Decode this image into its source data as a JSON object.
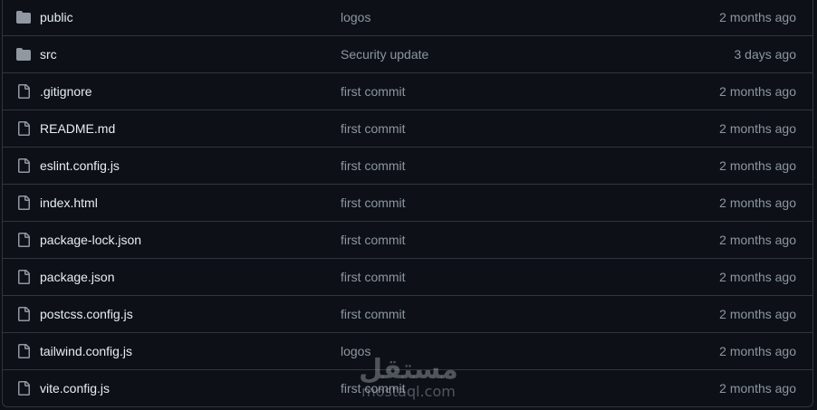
{
  "files": [
    {
      "name": "public",
      "type": "folder",
      "icon": "folder-icon",
      "commit": "logos",
      "date": "2 months ago"
    },
    {
      "name": "src",
      "type": "folder",
      "icon": "folder-icon",
      "commit": "Security update",
      "date": "3 days ago"
    },
    {
      "name": ".gitignore",
      "type": "file",
      "icon": "file-icon",
      "commit": "first commit",
      "date": "2 months ago"
    },
    {
      "name": "README.md",
      "type": "file",
      "icon": "file-icon",
      "commit": "first commit",
      "date": "2 months ago"
    },
    {
      "name": "eslint.config.js",
      "type": "file",
      "icon": "file-icon",
      "commit": "first commit",
      "date": "2 months ago"
    },
    {
      "name": "index.html",
      "type": "file",
      "icon": "file-icon",
      "commit": "first commit",
      "date": "2 months ago"
    },
    {
      "name": "package-lock.json",
      "type": "file",
      "icon": "file-icon",
      "commit": "first commit",
      "date": "2 months ago"
    },
    {
      "name": "package.json",
      "type": "file",
      "icon": "file-icon",
      "commit": "first commit",
      "date": "2 months ago"
    },
    {
      "name": "postcss.config.js",
      "type": "file",
      "icon": "file-icon",
      "commit": "first commit",
      "date": "2 months ago"
    },
    {
      "name": "tailwind.config.js",
      "type": "file",
      "icon": "file-icon",
      "commit": "logos",
      "date": "2 months ago"
    },
    {
      "name": "vite.config.js",
      "type": "file",
      "icon": "file-icon",
      "commit": "first commit",
      "date": "2 months ago"
    }
  ],
  "watermark": {
    "arabic": "مستقل",
    "latin": "mostaql.com"
  },
  "colors": {
    "background": "#0d1117",
    "border": "#30363d",
    "text_primary": "#e6edf3",
    "text_muted": "#8d96a0",
    "icon": "#9198a1"
  }
}
